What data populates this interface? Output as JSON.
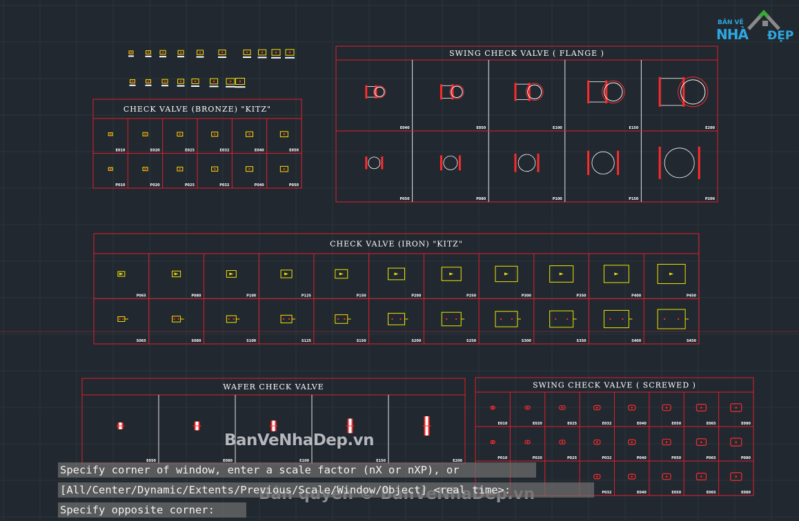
{
  "colors": {
    "background": "#212830",
    "frame": "#e41e2b",
    "title": "#ffffff",
    "yellow": "#f2e600",
    "red": "#ff2a2a",
    "white": "#ffffff",
    "logo": "#2ea7e0"
  },
  "panels": [
    {
      "key": "bronze",
      "title": "CHECK VALVE (BRONZE) \"KITZ\"",
      "rows": [
        [
          "E010",
          "E020",
          "E025",
          "E032",
          "E040",
          "E050"
        ],
        [
          "P010",
          "P020",
          "P025",
          "P032",
          "P040",
          "P050"
        ]
      ]
    },
    {
      "key": "flange",
      "title": "SWING CHECK VALVE ( FLANGE )",
      "rows": [
        [
          "E040",
          "E050",
          "E100",
          "E150",
          "E200"
        ],
        [
          "P050",
          "P080",
          "P100",
          "P150",
          "P200"
        ]
      ]
    },
    {
      "key": "iron",
      "title": "CHECK VALVE (IRON) \"KITZ\"",
      "rows": [
        [
          "P065",
          "P080",
          "P100",
          "P125",
          "P150",
          "P200",
          "P250",
          "P300",
          "P350",
          "P400",
          "P450"
        ],
        [
          "S065",
          "S080",
          "S100",
          "S125",
          "S150",
          "S200",
          "S250",
          "S300",
          "S350",
          "S400",
          "S450"
        ]
      ]
    },
    {
      "key": "wafer",
      "title": "WAFER CHECK VALVE",
      "rows": [
        [
          "E050",
          "E080",
          "E100",
          "E150",
          "E200"
        ]
      ]
    },
    {
      "key": "screwed",
      "title": "SWING CHECK VALVE ( SCREWED )",
      "rows": [
        [
          "E010",
          "E020",
          "E025",
          "E032",
          "E040",
          "E050",
          "E065",
          "E080"
        ],
        [
          "P010",
          "P020",
          "P025",
          "P032",
          "P040",
          "P050",
          "P065",
          "P080"
        ],
        [
          "",
          "",
          "",
          "P032",
          "E040",
          "E050",
          "E065",
          "E080"
        ]
      ]
    }
  ],
  "command_line": [
    "Specify corner of window, enter a scale factor (nX or nXP), or",
    "[All/Center/Dynamic/Extents/Previous/Scale/Window/Object] <real time>:",
    "Specify opposite corner:"
  ],
  "watermark": {
    "site": "BanVeNhaDep.vn",
    "copyright": "Bản quyền © BanVeNhaDep.vn"
  },
  "logo": {
    "top": "BẢN VẼ",
    "mid": "NHÀ",
    "end": "ĐẸP"
  }
}
